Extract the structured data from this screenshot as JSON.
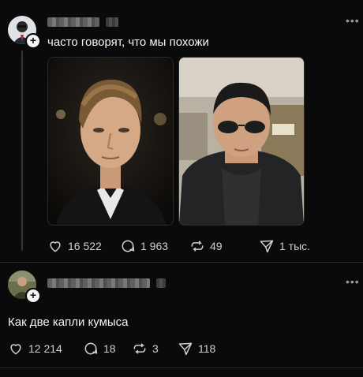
{
  "post1": {
    "text": "часто говорят, что мы похожи",
    "stats": {
      "likes": "16 522",
      "comments": "1 963",
      "reposts": "49",
      "shares": "1 тыс."
    }
  },
  "post2": {
    "text": "Как две капли кумыса",
    "stats": {
      "likes": "12 214",
      "comments": "18",
      "reposts": "3",
      "shares": "118"
    }
  },
  "icons": {
    "like": "heart-icon",
    "comment": "comment-bubble-icon",
    "repost": "repost-icon",
    "share": "send-icon",
    "more": "more-dots-icon",
    "follow": "plus-icon"
  },
  "colors": {
    "background": "#0a0a0a",
    "text": "#f3f5f7",
    "secondary": "#cfcfcf"
  }
}
